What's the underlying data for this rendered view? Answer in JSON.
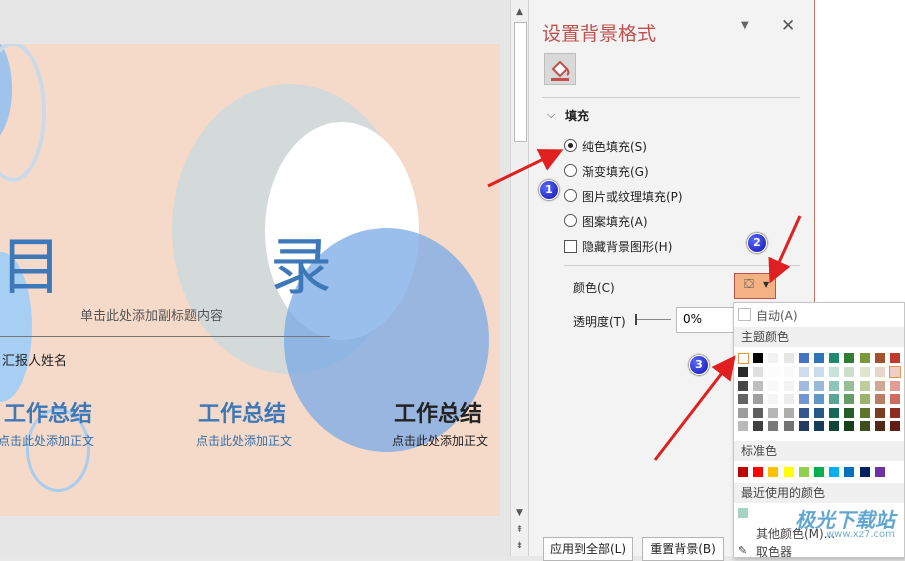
{
  "slide": {
    "title_left": "目",
    "title_right": "录",
    "subtitle": "单击此处添加副标题内容",
    "reporter": "汇报人姓名",
    "sections": [
      {
        "heading": "工作总结",
        "body": "点击此处添加正文"
      },
      {
        "heading": "工作总结",
        "body": "点击此处添加正文"
      },
      {
        "heading": "工作总结",
        "body": "点击此处添加正文"
      }
    ]
  },
  "pane": {
    "title": "设置背景格式",
    "section_fill": "填充",
    "options": [
      "纯色填充(S)",
      "渐变填充(G)",
      "图片或纹理填充(P)",
      "图案填充(A)"
    ],
    "selected_option": "纯色填充(S)",
    "hide_bg": "隐藏背景图形(H)",
    "color_label": "颜色(C)",
    "transparency_label": "透明度(T)",
    "transparency_value": "0%",
    "apply_all": "应用到全部(L)",
    "reset_bg": "重置背景(B)"
  },
  "color_menu": {
    "auto": "自动(A)",
    "theme_colors": "主题颜色",
    "standard_colors": "标准色",
    "recent_colors": "最近使用的颜色",
    "more_colors": "其他颜色(M)...",
    "eyedropper": "取色器",
    "theme_top": [
      "#ffffff",
      "#000000",
      "#f2f2f2",
      "#e7e6e6",
      "#4472c4",
      "#2e75b6",
      "#1f8a70",
      "#2e7d32",
      "#7a9a3a",
      "#a0522d",
      "#c0392b"
    ],
    "standard": [
      "#c00000",
      "#ff0000",
      "#ffc000",
      "#ffff00",
      "#92d050",
      "#00b050",
      "#00b0f0",
      "#0070c0",
      "#002060",
      "#7030a0"
    ]
  },
  "badges": [
    "1",
    "2",
    "3"
  ],
  "watermark": "极光下载站",
  "watermark_url": "www.xz7.com"
}
